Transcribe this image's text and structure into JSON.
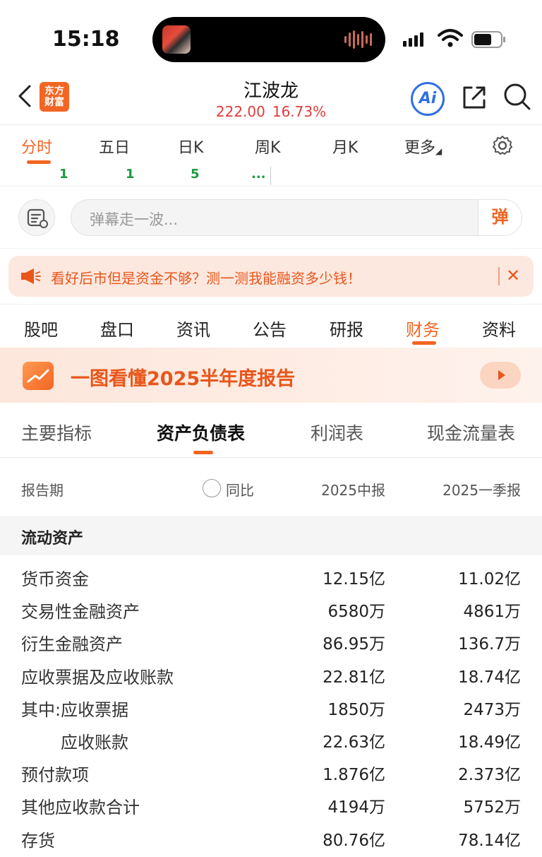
{
  "status_bar": {
    "time": "15:18"
  },
  "header": {
    "logo_line1": "东方",
    "logo_line2": "财富",
    "stock_name": "江波龙",
    "price": "222.00",
    "change_pct": "16.73%",
    "ai_label": "Ai"
  },
  "chart_tabs": [
    "分时",
    "五日",
    "日K",
    "周K",
    "月K",
    "更多"
  ],
  "chart_sub_numbers": [
    "1",
    "1",
    "5",
    "..."
  ],
  "danmaku": {
    "placeholder": "弹幕走一波...",
    "send_label": "弹"
  },
  "banner": {
    "text": "看好后市但是资金不够？测一测我能融资多少钱！",
    "close": "✕"
  },
  "section_tabs": [
    "股吧",
    "盘口",
    "资讯",
    "公告",
    "研报",
    "财务",
    "资料"
  ],
  "promo": {
    "text": "一图看懂2025半年度报告"
  },
  "finance_tabs": [
    "主要指标",
    "资产负债表",
    "利润表",
    "现金流量表"
  ],
  "table": {
    "col_period": "报告期",
    "col_yoy": "同比",
    "col_1": "2025中报",
    "col_2": "2025一季报",
    "group": "流动资产",
    "rows": [
      {
        "label": "货币资金",
        "v1": "12.15亿",
        "v2": "11.02亿"
      },
      {
        "label": "交易性金融资产",
        "v1": "6580万",
        "v2": "4861万"
      },
      {
        "label": "衍生金融资产",
        "v1": "86.95万",
        "v2": "136.7万"
      },
      {
        "label": "应收票据及应收账款",
        "v1": "22.81亿",
        "v2": "18.74亿"
      },
      {
        "label": "其中:应收票据",
        "v1": "1850万",
        "v2": "2473万"
      },
      {
        "label": "应收账款",
        "v1": "22.63亿",
        "v2": "18.49亿"
      },
      {
        "label": "预付款项",
        "v1": "1.876亿",
        "v2": "2.373亿"
      },
      {
        "label": "其他应收款合计",
        "v1": "4194万",
        "v2": "5752万"
      },
      {
        "label": "存货",
        "v1": "80.76亿",
        "v2": "78.14亿"
      }
    ]
  },
  "colors": {
    "accent": "#f26522",
    "price_up": "#e23b3b",
    "ai_blue": "#2f6fe4"
  }
}
